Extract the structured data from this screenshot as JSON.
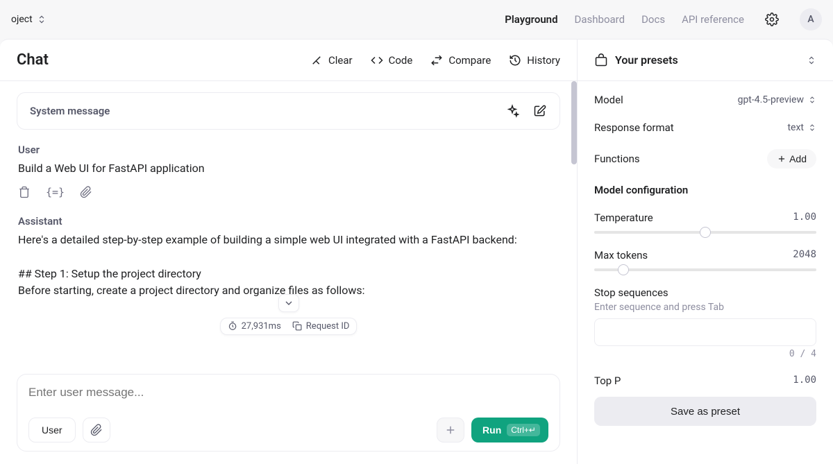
{
  "topbar": {
    "project_label": "oject",
    "nav": {
      "playground": "Playground",
      "dashboard": "Dashboard",
      "docs": "Docs",
      "api_reference": "API reference"
    },
    "avatar_initial": "A"
  },
  "chat": {
    "title": "Chat",
    "actions": {
      "clear": "Clear",
      "code": "Code",
      "compare": "Compare",
      "history": "History"
    },
    "system_message_label": "System message",
    "messages": {
      "user_role": "User",
      "user_text": "Build a Web UI for FastAPI application",
      "assistant_role": "Assistant",
      "assistant_line1": "Here's a detailed step-by-step example of building a simple web UI integrated with a FastAPI backend:",
      "assistant_line2": "## Step 1: Setup the project directory",
      "assistant_line3": "Before starting, create a project directory and organize files as follows:"
    },
    "meta": {
      "latency": "27,931ms",
      "request_id_label": "Request ID"
    },
    "composer": {
      "placeholder": "Enter user message...",
      "role_button": "User",
      "run_label": "Run",
      "run_kbd": "Ctrl+↵"
    }
  },
  "presets": {
    "header": "Your presets",
    "model_label": "Model",
    "model_value": "gpt-4.5-preview",
    "response_format_label": "Response format",
    "response_format_value": "text",
    "functions_label": "Functions",
    "functions_add": "Add",
    "config_title": "Model configuration",
    "temperature_label": "Temperature",
    "temperature_value": "1.00",
    "temperature_percent": 50,
    "max_tokens_label": "Max tokens",
    "max_tokens_value": "2048",
    "max_tokens_percent": 13,
    "stop_label": "Stop sequences",
    "stop_hint": "Enter sequence and press Tab",
    "stop_count": "0 / 4",
    "top_p_label": "Top P",
    "top_p_value": "1.00",
    "save_preset": "Save as preset"
  }
}
